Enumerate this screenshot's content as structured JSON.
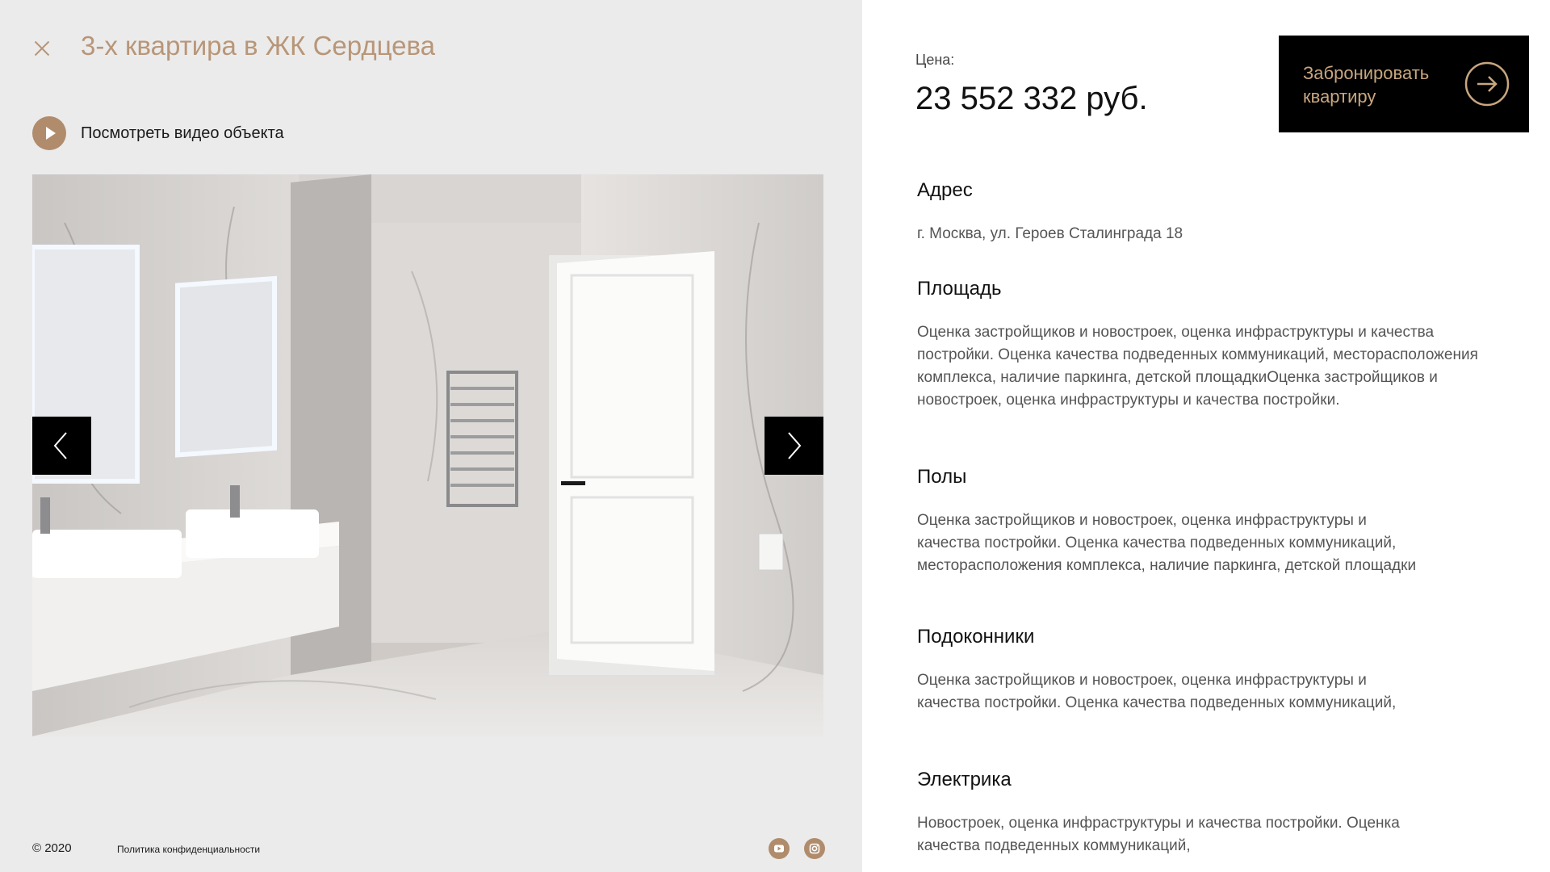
{
  "header": {
    "title": "3-х квартира в ЖК Сердцева",
    "video_label": "Посмотреть видео объекта"
  },
  "gallery": {
    "image_alt": "bathroom-photo"
  },
  "footer": {
    "copyright": "© 2020",
    "policy": "Политика конфиденциальности",
    "social": [
      "youtube-icon",
      "instagram-icon"
    ]
  },
  "price": {
    "label": "Цена:",
    "value": "23 552 332 руб."
  },
  "booking": {
    "label": "Забронировать квартиру"
  },
  "details": [
    {
      "title": "Адрес",
      "text": "г. Москва, ул. Героев Сталинграда 18"
    },
    {
      "title": "Площадь",
      "text": "Оценка застройщиков и новостроек, оценка инфраструктуры и качества постройки. Оценка качества подведенных коммуникаций, месторасположения комплекса, наличие паркинга, детской площадкиОценка застройщиков и новостроек, оценка инфраструктуры и качества постройки."
    },
    {
      "title": "Полы",
      "text": "Оценка застройщиков и новостроек, оценка инфраструктуры и качества постройки. Оценка качества подведенных коммуникаций, месторасположения комплекса, наличие паркинга, детской площадки"
    },
    {
      "title": "Подоконники",
      "text": "Оценка застройщиков и новостроек, оценка инфраструктуры и качества постройки. Оценка качества подведенных коммуникаций,"
    },
    {
      "title": "Электрика",
      "text": "Новостроек, оценка инфраструктуры и качества постройки. Оценка качества подведенных коммуникаций,"
    }
  ],
  "colors": {
    "accent": "#b89678",
    "accent_dark": "#b08c6c",
    "button_bg": "#000000",
    "button_text": "#c9a67e",
    "left_bg": "#ebebeb"
  }
}
